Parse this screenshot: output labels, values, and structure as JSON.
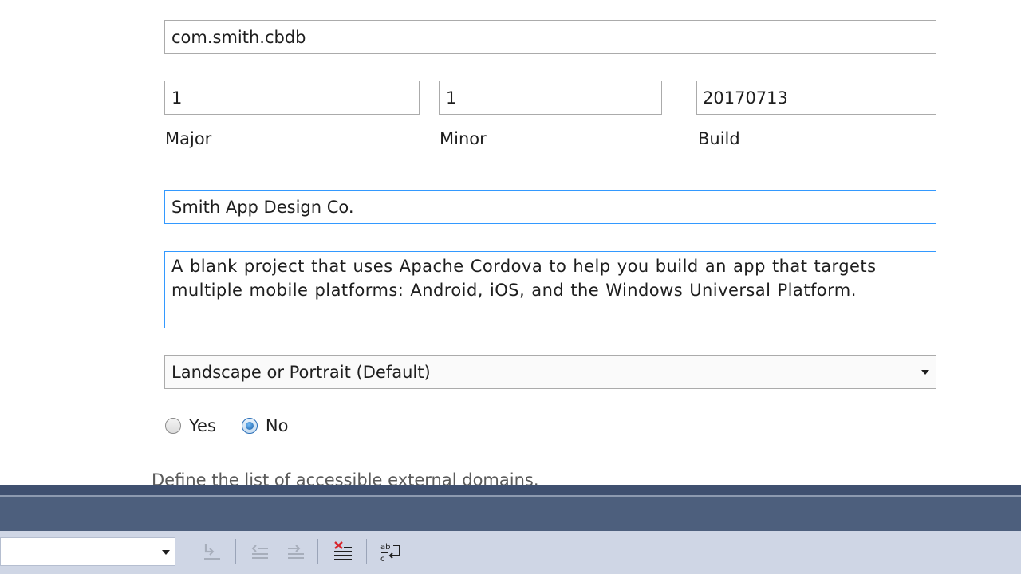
{
  "form": {
    "package_name": "com.smith.cbdb",
    "version": {
      "major_value": "1",
      "minor_value": "1",
      "build_value": "20170713",
      "major_label": "Major",
      "minor_label": "Minor",
      "build_label": "Build"
    },
    "publisher": "Smith App Design Co.",
    "description": "A blank project that uses Apache Cordova to help you build an app that targets multiple mobile platforms: Android, iOS, and the Windows Universal Platform.",
    "orientation": {
      "selected": "Landscape or Portrait (Default)"
    },
    "radio": {
      "yes_label": "Yes",
      "no_label": "No",
      "selected": "No"
    },
    "domains_hint": "Define the list of accessible external domains."
  },
  "toolbar": {
    "icons": [
      "clear-icon-disabled",
      "outdent-icon-disabled",
      "indent-icon-disabled",
      "clear-all-icon",
      "word-wrap-icon"
    ]
  },
  "colors": {
    "focus_border": "#3399ff",
    "dark_bar": "#4d5f7d",
    "toolbar_bg": "#cfd6e5"
  }
}
